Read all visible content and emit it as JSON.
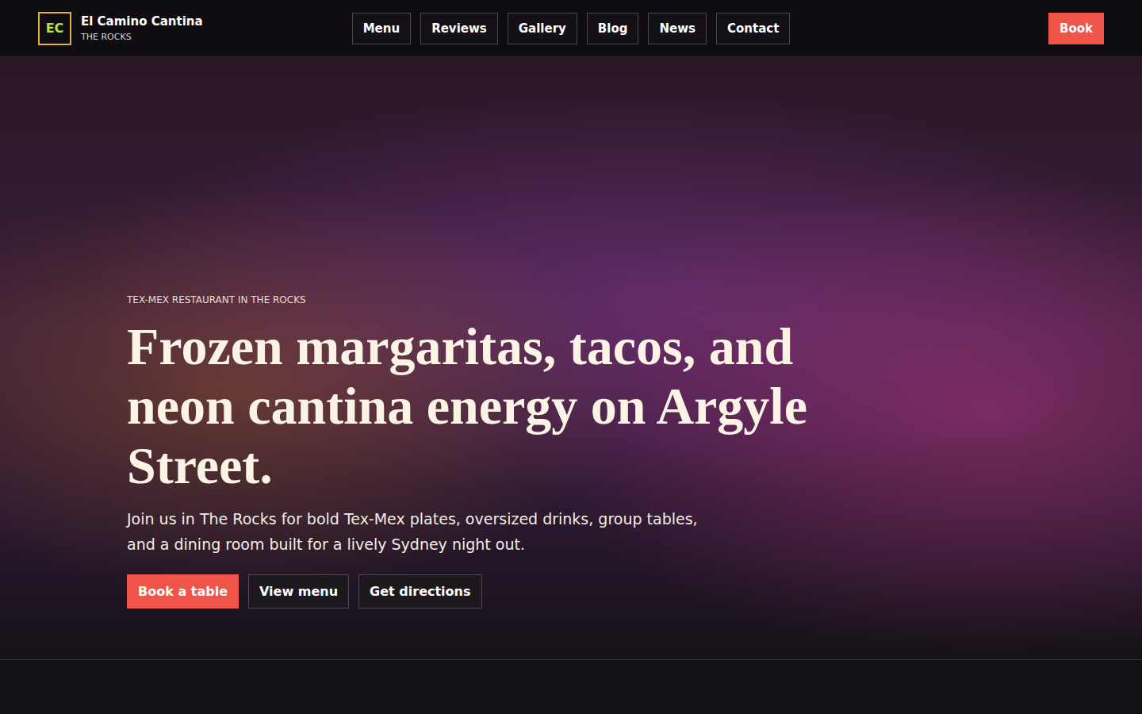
{
  "brand": {
    "logo": "EC",
    "name": "El Camino Cantina",
    "subtitle": "THE ROCKS"
  },
  "nav": [
    "Menu",
    "Reviews",
    "Gallery",
    "Blog",
    "News",
    "Contact"
  ],
  "book_button": "Book",
  "hero": {
    "eyebrow": "TEX-MEX RESTAURANT IN THE ROCKS",
    "title": "Frozen margaritas, tacos, and neon cantina energy on Argyle Street.",
    "text": "Join us in The Rocks for bold Tex-Mex plates, oversized drinks, group tables, and a dining room built for a lively Sydney night out.",
    "buttons": [
      {
        "label": "Book a table",
        "kind": "primary"
      },
      {
        "label": "View menu",
        "kind": "secondary"
      },
      {
        "label": "Get directions",
        "kind": "secondary"
      }
    ]
  }
}
